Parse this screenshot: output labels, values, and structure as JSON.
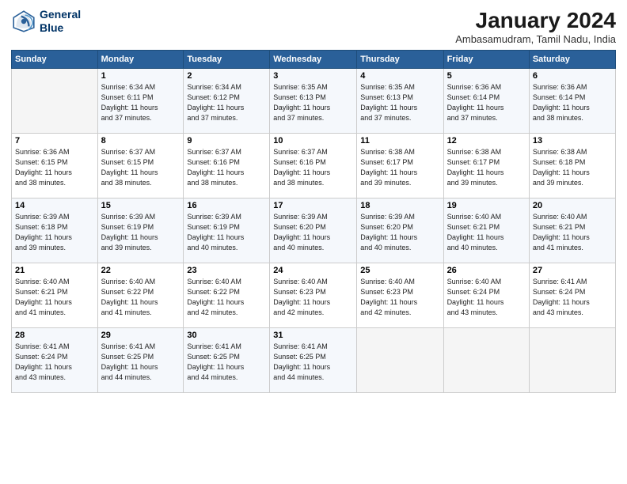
{
  "header": {
    "logo_line1": "General",
    "logo_line2": "Blue",
    "title": "January 2024",
    "subtitle": "Ambasamudram, Tamil Nadu, India"
  },
  "weekdays": [
    "Sunday",
    "Monday",
    "Tuesday",
    "Wednesday",
    "Thursday",
    "Friday",
    "Saturday"
  ],
  "weeks": [
    [
      {
        "num": "",
        "info": ""
      },
      {
        "num": "1",
        "info": "Sunrise: 6:34 AM\nSunset: 6:11 PM\nDaylight: 11 hours\nand 37 minutes."
      },
      {
        "num": "2",
        "info": "Sunrise: 6:34 AM\nSunset: 6:12 PM\nDaylight: 11 hours\nand 37 minutes."
      },
      {
        "num": "3",
        "info": "Sunrise: 6:35 AM\nSunset: 6:13 PM\nDaylight: 11 hours\nand 37 minutes."
      },
      {
        "num": "4",
        "info": "Sunrise: 6:35 AM\nSunset: 6:13 PM\nDaylight: 11 hours\nand 37 minutes."
      },
      {
        "num": "5",
        "info": "Sunrise: 6:36 AM\nSunset: 6:14 PM\nDaylight: 11 hours\nand 37 minutes."
      },
      {
        "num": "6",
        "info": "Sunrise: 6:36 AM\nSunset: 6:14 PM\nDaylight: 11 hours\nand 38 minutes."
      }
    ],
    [
      {
        "num": "7",
        "info": "Sunrise: 6:36 AM\nSunset: 6:15 PM\nDaylight: 11 hours\nand 38 minutes."
      },
      {
        "num": "8",
        "info": "Sunrise: 6:37 AM\nSunset: 6:15 PM\nDaylight: 11 hours\nand 38 minutes."
      },
      {
        "num": "9",
        "info": "Sunrise: 6:37 AM\nSunset: 6:16 PM\nDaylight: 11 hours\nand 38 minutes."
      },
      {
        "num": "10",
        "info": "Sunrise: 6:37 AM\nSunset: 6:16 PM\nDaylight: 11 hours\nand 38 minutes."
      },
      {
        "num": "11",
        "info": "Sunrise: 6:38 AM\nSunset: 6:17 PM\nDaylight: 11 hours\nand 39 minutes."
      },
      {
        "num": "12",
        "info": "Sunrise: 6:38 AM\nSunset: 6:17 PM\nDaylight: 11 hours\nand 39 minutes."
      },
      {
        "num": "13",
        "info": "Sunrise: 6:38 AM\nSunset: 6:18 PM\nDaylight: 11 hours\nand 39 minutes."
      }
    ],
    [
      {
        "num": "14",
        "info": "Sunrise: 6:39 AM\nSunset: 6:18 PM\nDaylight: 11 hours\nand 39 minutes."
      },
      {
        "num": "15",
        "info": "Sunrise: 6:39 AM\nSunset: 6:19 PM\nDaylight: 11 hours\nand 39 minutes."
      },
      {
        "num": "16",
        "info": "Sunrise: 6:39 AM\nSunset: 6:19 PM\nDaylight: 11 hours\nand 40 minutes."
      },
      {
        "num": "17",
        "info": "Sunrise: 6:39 AM\nSunset: 6:20 PM\nDaylight: 11 hours\nand 40 minutes."
      },
      {
        "num": "18",
        "info": "Sunrise: 6:39 AM\nSunset: 6:20 PM\nDaylight: 11 hours\nand 40 minutes."
      },
      {
        "num": "19",
        "info": "Sunrise: 6:40 AM\nSunset: 6:21 PM\nDaylight: 11 hours\nand 40 minutes."
      },
      {
        "num": "20",
        "info": "Sunrise: 6:40 AM\nSunset: 6:21 PM\nDaylight: 11 hours\nand 41 minutes."
      }
    ],
    [
      {
        "num": "21",
        "info": "Sunrise: 6:40 AM\nSunset: 6:21 PM\nDaylight: 11 hours\nand 41 minutes."
      },
      {
        "num": "22",
        "info": "Sunrise: 6:40 AM\nSunset: 6:22 PM\nDaylight: 11 hours\nand 41 minutes."
      },
      {
        "num": "23",
        "info": "Sunrise: 6:40 AM\nSunset: 6:22 PM\nDaylight: 11 hours\nand 42 minutes."
      },
      {
        "num": "24",
        "info": "Sunrise: 6:40 AM\nSunset: 6:23 PM\nDaylight: 11 hours\nand 42 minutes."
      },
      {
        "num": "25",
        "info": "Sunrise: 6:40 AM\nSunset: 6:23 PM\nDaylight: 11 hours\nand 42 minutes."
      },
      {
        "num": "26",
        "info": "Sunrise: 6:40 AM\nSunset: 6:24 PM\nDaylight: 11 hours\nand 43 minutes."
      },
      {
        "num": "27",
        "info": "Sunrise: 6:41 AM\nSunset: 6:24 PM\nDaylight: 11 hours\nand 43 minutes."
      }
    ],
    [
      {
        "num": "28",
        "info": "Sunrise: 6:41 AM\nSunset: 6:24 PM\nDaylight: 11 hours\nand 43 minutes."
      },
      {
        "num": "29",
        "info": "Sunrise: 6:41 AM\nSunset: 6:25 PM\nDaylight: 11 hours\nand 44 minutes."
      },
      {
        "num": "30",
        "info": "Sunrise: 6:41 AM\nSunset: 6:25 PM\nDaylight: 11 hours\nand 44 minutes."
      },
      {
        "num": "31",
        "info": "Sunrise: 6:41 AM\nSunset: 6:25 PM\nDaylight: 11 hours\nand 44 minutes."
      },
      {
        "num": "",
        "info": ""
      },
      {
        "num": "",
        "info": ""
      },
      {
        "num": "",
        "info": ""
      }
    ]
  ]
}
